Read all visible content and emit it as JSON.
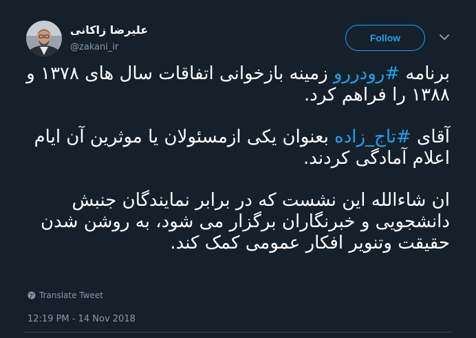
{
  "author": {
    "display_name": "علیرضا زاکانی",
    "handle": "@zakani_ir",
    "avatar": "profile-photo"
  },
  "follow_label": "Follow",
  "more_icon": "chevron-down-icon",
  "tweet": {
    "p1_prefix": "برنامه ",
    "p1_hashtag": "#رودررو",
    "p1_suffix": " زمینه بازخوانی اتفاقات سال های ۱۳۷۸ و ۱۳۸۸ را فراهم کرد.",
    "p2_prefix": "آقای ",
    "p2_hashtag": "#تاج_زاده",
    "p2_suffix": " بعنوان یکی ازمسئولان یا موثرین آن ایام اعلام آمادگی کردند.",
    "p3": "ان شاءالله این نشست که در برابر نمایندگان جنبش دانشجویی و خبرنگاران برگزار می شود، به روشن شدن حقیقت وتنویر افکار عمومی کمک کند."
  },
  "translate_label": "Translate Tweet",
  "timestamp": "12:19 PM - 14 Nov 2018",
  "colors": {
    "background": "#15202b",
    "accent": "#1da1f2",
    "secondary_text": "#8899a6"
  }
}
